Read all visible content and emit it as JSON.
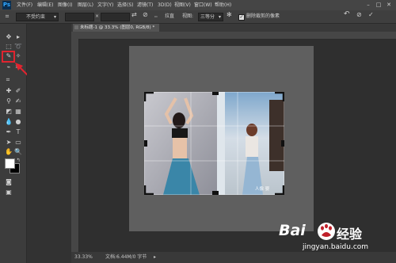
{
  "app": {
    "logo": "Ps"
  },
  "menubar": {
    "items": [
      "文件(F)",
      "编辑(E)",
      "图像(I)",
      "图层(L)",
      "文字(Y)",
      "选择(S)",
      "滤镜(T)",
      "3D(D)",
      "视图(V)",
      "窗口(W)",
      "帮助(H)"
    ],
    "window_controls": [
      "minimize-icon",
      "maximize-icon",
      "close-icon"
    ]
  },
  "options": {
    "preset": "不受约束",
    "ratio_sep": "×",
    "straighten_label": "拉直",
    "view_label": "视图:",
    "view_value": "三等分",
    "delete_cropped_label": "删除裁剪的像素",
    "delete_cropped_checked": true
  },
  "document": {
    "tab_title": "未标题-1 @ 33.3% (图层0, RGB/8) *"
  },
  "photo_watermark": {
    "text": "人像 婴"
  },
  "status": {
    "zoom": "33.33%",
    "doc_info": "文档:6.44M/0 字节"
  },
  "watermark": {
    "brand": "Bai",
    "paw": "du",
    "suffix": "经验",
    "url": "jingyan.baidu.com"
  },
  "colors": {
    "crop_highlight": "#e0242f",
    "arrow": "#e0242f",
    "foreground": "#ffffff",
    "background": "#000000"
  }
}
